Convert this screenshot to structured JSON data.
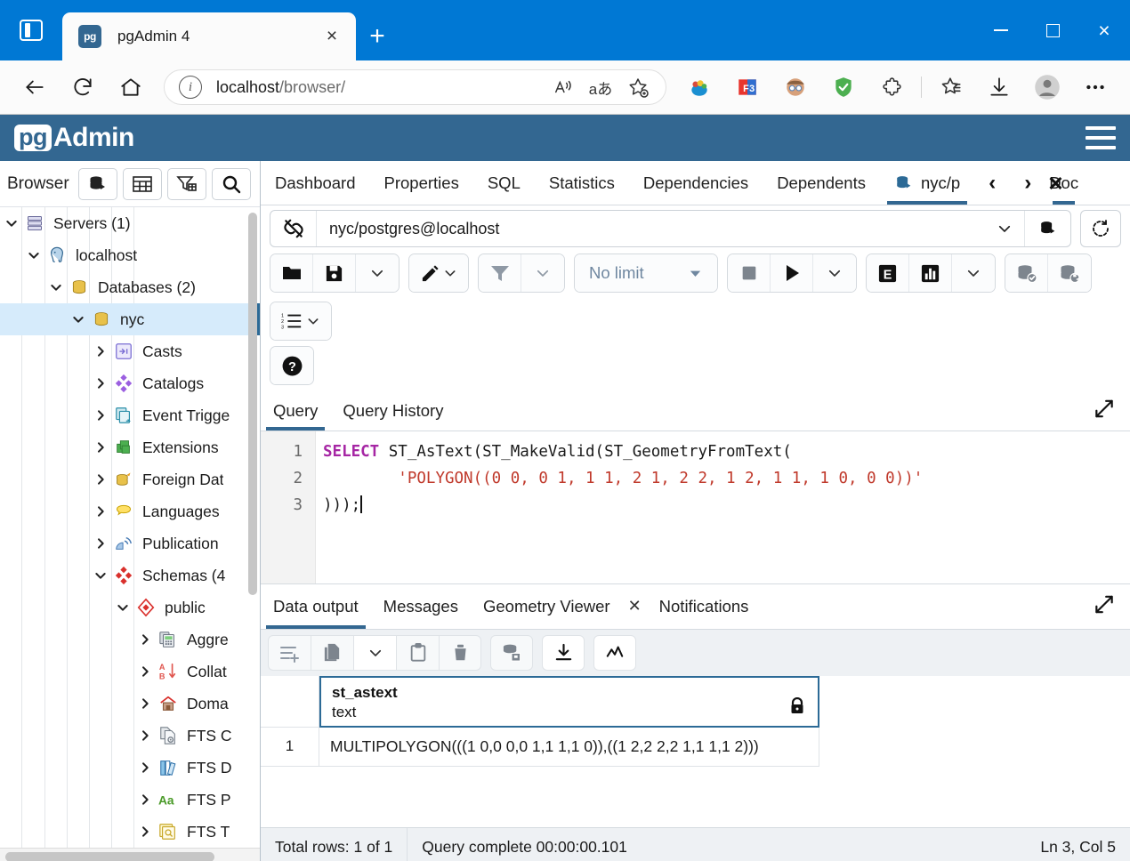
{
  "browser": {
    "tab": {
      "favicon_text": "pg",
      "title": "pgAdmin 4",
      "close": "×"
    },
    "new_tab": "+",
    "url": {
      "value": "localhost/browser/",
      "host": "localhost",
      "path": "/browser/"
    },
    "window_controls": {
      "minimize": "—",
      "maximize": "□",
      "close": "×"
    }
  },
  "pgadmin": {
    "logo_pg": "pg",
    "logo_admin": "Admin"
  },
  "sidebar": {
    "title": "Browser",
    "buttons": [
      "object-explorer-icon",
      "table-icon",
      "filter-icon",
      "search-icon"
    ],
    "tree": [
      {
        "label": "Servers (1)",
        "indent": 0,
        "state": "expanded",
        "icon": "servers-icon",
        "selected": false
      },
      {
        "label": "localhost",
        "indent": 1,
        "state": "expanded",
        "icon": "postgres-elephant-icon",
        "selected": false
      },
      {
        "label": "Databases (2)",
        "indent": 2,
        "state": "expanded",
        "icon": "databases-icon",
        "selected": false
      },
      {
        "label": "nyc",
        "indent": 3,
        "state": "expanded",
        "icon": "database-icon",
        "selected": true
      },
      {
        "label": "Casts",
        "indent": 4,
        "state": "collapsed",
        "icon": "casts-icon",
        "selected": false
      },
      {
        "label": "Catalogs",
        "indent": 4,
        "state": "collapsed",
        "icon": "catalogs-icon",
        "selected": false
      },
      {
        "label": "Event Trigge",
        "indent": 4,
        "state": "collapsed",
        "icon": "event-triggers-icon",
        "selected": false
      },
      {
        "label": "Extensions",
        "indent": 4,
        "state": "collapsed",
        "icon": "extensions-icon",
        "selected": false
      },
      {
        "label": "Foreign Dat",
        "indent": 4,
        "state": "collapsed",
        "icon": "foreign-data-wrappers-icon",
        "selected": false
      },
      {
        "label": "Languages",
        "indent": 4,
        "state": "collapsed",
        "icon": "languages-icon",
        "selected": false
      },
      {
        "label": "Publication",
        "indent": 4,
        "state": "collapsed",
        "icon": "publications-icon",
        "selected": false
      },
      {
        "label": "Schemas (4",
        "indent": 4,
        "state": "expanded",
        "icon": "schemas-icon",
        "selected": false
      },
      {
        "label": "public",
        "indent": 5,
        "state": "expanded",
        "icon": "schema-icon",
        "selected": false
      },
      {
        "label": "Aggre",
        "indent": 6,
        "state": "collapsed",
        "icon": "aggregates-icon",
        "selected": false
      },
      {
        "label": "Collat",
        "indent": 6,
        "state": "collapsed",
        "icon": "collations-icon",
        "selected": false
      },
      {
        "label": "Doma",
        "indent": 6,
        "state": "collapsed",
        "icon": "domains-icon",
        "selected": false
      },
      {
        "label": "FTS C",
        "indent": 6,
        "state": "collapsed",
        "icon": "fts-configurations-icon",
        "selected": false
      },
      {
        "label": "FTS D",
        "indent": 6,
        "state": "collapsed",
        "icon": "fts-dictionaries-icon",
        "selected": false
      },
      {
        "label": "FTS P",
        "indent": 6,
        "state": "collapsed",
        "icon": "fts-parsers-icon",
        "selected": false
      },
      {
        "label": "FTS T",
        "indent": 6,
        "state": "collapsed",
        "icon": "fts-templates-icon",
        "selected": false
      }
    ]
  },
  "object_tabs": {
    "items": [
      {
        "label": "Dashboard",
        "active": false
      },
      {
        "label": "Properties",
        "active": false
      },
      {
        "label": "SQL",
        "active": false
      },
      {
        "label": "Statistics",
        "active": false
      },
      {
        "label": "Dependencies",
        "active": false
      },
      {
        "label": "Dependents",
        "active": false
      }
    ],
    "query_tool_tab": {
      "label": "nyc/p",
      "active": true
    },
    "nav_prev": "‹",
    "nav_next": "›",
    "clipped_tab": "Doc",
    "close": "✕"
  },
  "query_tool": {
    "connection": "nyc/postgres@localhost",
    "limit": "No limit",
    "toolbar": [
      "open-file-icon",
      "save-file-icon",
      "save-dropdown-caret",
      "edit-icon",
      "edit-dropdown-caret",
      "filter-icon",
      "filter-dropdown-caret",
      "row-limit-select",
      "stop-icon",
      "execute-play-icon",
      "execute-dropdown-caret",
      "explain-icon",
      "explain-analyze-icon",
      "explain-dropdown-caret",
      "commit-icon",
      "rollback-icon",
      "macros-icon",
      "help-icon"
    ],
    "tabs": [
      {
        "label": "Query",
        "active": true
      },
      {
        "label": "Query History",
        "active": false
      }
    ],
    "editor": {
      "lines": [
        "1",
        "2",
        "3"
      ],
      "line1_keyword": "SELECT",
      "line1_rest": " ST_AsText(ST_MakeValid(ST_GeometryFromText(",
      "line2_indent": "        ",
      "line2_string": "'POLYGON((0 0, 0 1, 1 1, 2 1, 2 2, 1 2, 1 1, 1 0, 0 0))'",
      "line3": ")));"
    }
  },
  "output": {
    "tabs": [
      {
        "label": "Data output",
        "active": true,
        "closable": false
      },
      {
        "label": "Messages",
        "active": false,
        "closable": false
      },
      {
        "label": "Geometry Viewer",
        "active": false,
        "closable": true
      },
      {
        "label": "Notifications",
        "active": false,
        "closable": false
      }
    ],
    "close_glyph": "✕",
    "grid_toolbar": [
      "add-row-icon",
      "copy-icon",
      "copy-dropdown-caret",
      "paste-icon",
      "delete-row-icon",
      "save-data-changes-icon",
      "download-csv-icon",
      "graph-visualiser-icon"
    ],
    "columns": [
      {
        "name": "st_astext",
        "type": "text",
        "locked": true
      }
    ],
    "rows": [
      {
        "num": "1",
        "values": [
          "MULTIPOLYGON(((1 0,0 0,0 1,1 1,1 0)),((1 2,2 2,2 1,1 1,1 2)))"
        ]
      }
    ]
  },
  "status_bar": {
    "total_rows": "Total rows: 1 of 1",
    "query_status": "Query complete 00:00:00.101",
    "cursor_position": "Ln 3, Col 5"
  },
  "colors": {
    "browser_accent": "#0078d4",
    "pgadmin_header": "#336791",
    "tab_underline": "#336791",
    "selection_bg": "#d6ebfb",
    "grid_focus_border": "#2c6a96",
    "sql_keyword": "#a626a4",
    "sql_string": "#c0392b"
  }
}
